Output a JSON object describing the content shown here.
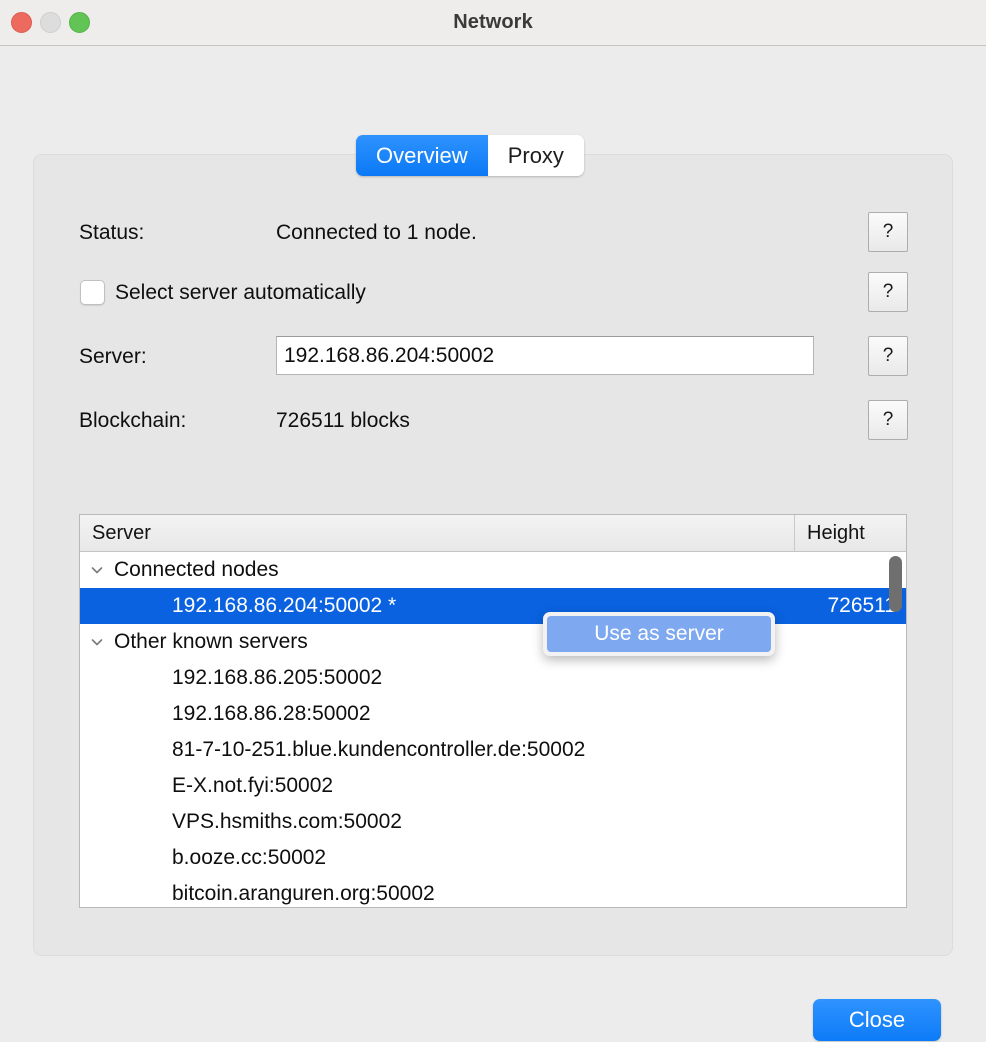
{
  "window": {
    "title": "Network",
    "traffic_lights": {
      "close": "close-button-red",
      "minimize": "minimize-button-gray",
      "maximize": "maximize-button-green"
    }
  },
  "tabs": [
    {
      "label": "Overview",
      "active": true
    },
    {
      "label": "Proxy",
      "active": false
    }
  ],
  "form": {
    "status_label": "Status:",
    "status_value": "Connected to 1 node.",
    "auto_select_label": "Select server automatically",
    "auto_select_checked": false,
    "server_label": "Server:",
    "server_value": "192.168.86.204:50002",
    "server_placeholder": "",
    "blockchain_label": "Blockchain:",
    "blockchain_value": "726511 blocks",
    "help_label": "?"
  },
  "table": {
    "columns": {
      "server": "Server",
      "height": "Height"
    },
    "groups": [
      {
        "label": "Connected nodes",
        "expanded": true,
        "chevron": "chevron-down-icon",
        "rows": [
          {
            "server": "192.168.86.204:50002 *",
            "height": "726511",
            "selected": true
          }
        ]
      },
      {
        "label": "Other known servers",
        "expanded": true,
        "chevron": "chevron-down-icon",
        "rows": [
          {
            "server": "192.168.86.205:50002",
            "height": "",
            "selected": false
          },
          {
            "server": "192.168.86.28:50002",
            "height": "",
            "selected": false
          },
          {
            "server": "81-7-10-251.blue.kundencontroller.de:50002",
            "height": "",
            "selected": false
          },
          {
            "server": "E-X.not.fyi:50002",
            "height": "",
            "selected": false
          },
          {
            "server": "VPS.hsmiths.com:50002",
            "height": "",
            "selected": false
          },
          {
            "server": "b.ooze.cc:50002",
            "height": "",
            "selected": false
          },
          {
            "server": "bitcoin.aranguren.org:50002",
            "height": "",
            "selected": false
          }
        ]
      }
    ]
  },
  "context_menu": {
    "items": [
      {
        "label": "Use as server",
        "highlighted": true
      }
    ]
  },
  "footer": {
    "close_label": "Close"
  },
  "colors": {
    "accent_blue": "#0a78f5",
    "selection_blue": "#0a62e0",
    "menu_highlight": "#7ea8f0",
    "window_bg": "#ececec",
    "groupbox_bg": "#e6e6e6"
  }
}
